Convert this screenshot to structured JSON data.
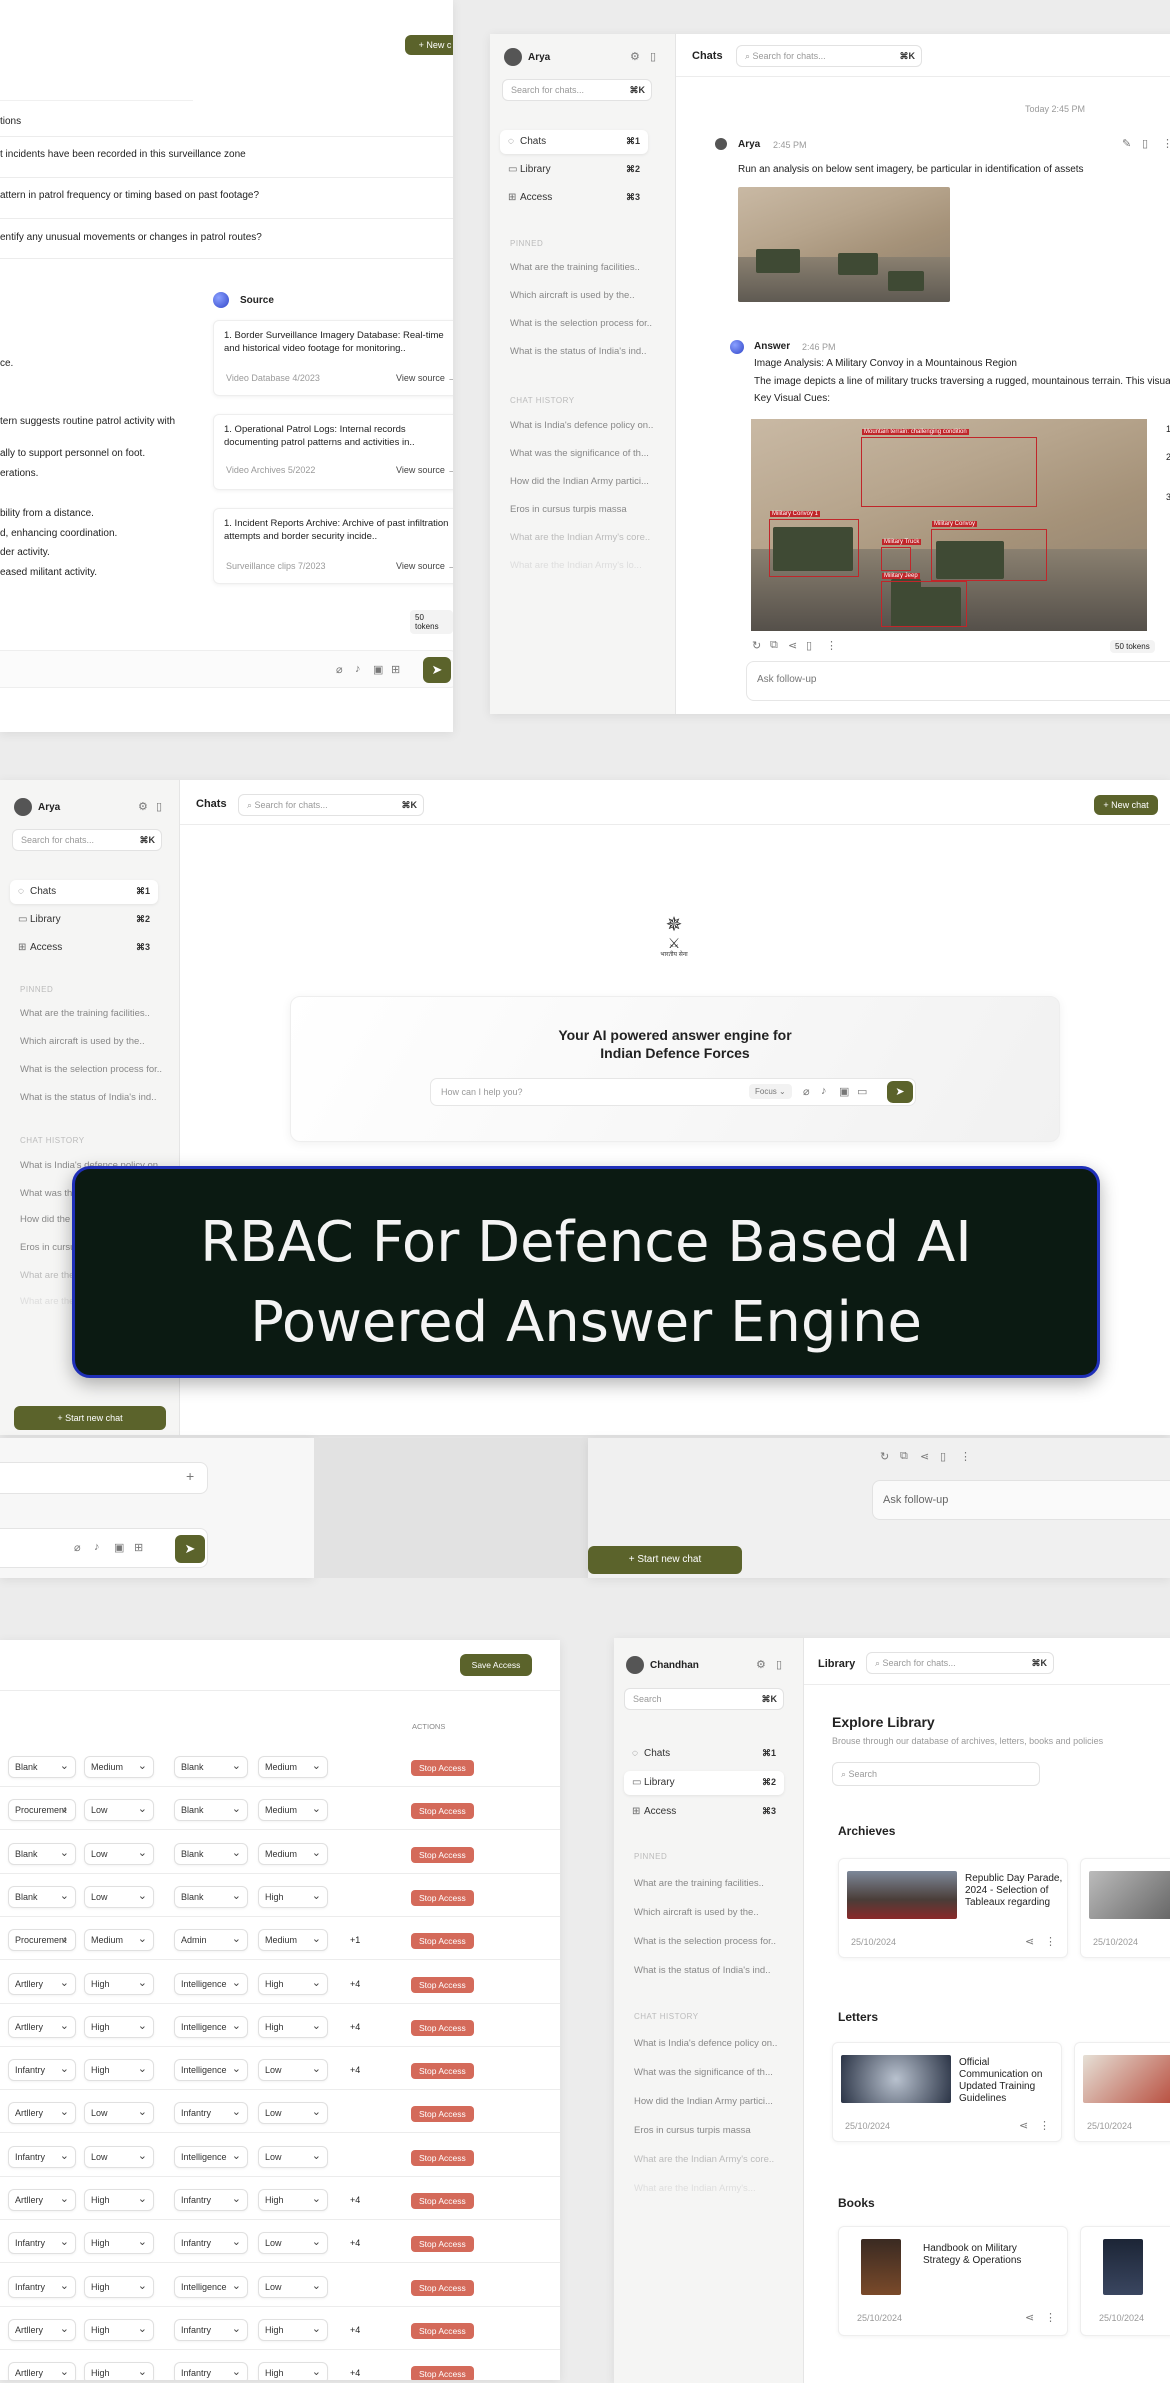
{
  "banner": {
    "line1": "RBAC For Defence Based AI",
    "line2": "Powered Answer Engine"
  },
  "panel1": {
    "new_chat": "+ New c",
    "related_header": "tions",
    "related": [
      "t incidents have been recorded in this surveillance zone",
      "attern in patrol frequency or timing based on past footage?",
      "entify any unusual movements or changes in patrol routes?"
    ],
    "answer_lines": [
      "ce.",
      "tern suggests routine patrol activity with",
      "ally to support personnel on foot.",
      "erations.",
      "bility from a distance.",
      "d, enhancing coordination.",
      "der activity.",
      "eased militant activity."
    ],
    "source_title": "Source",
    "sources": [
      {
        "text": "1. Border Surveillance Imagery Database: Real-time and historical video footage for monitoring..",
        "meta": "Video Database 4/2023",
        "link": "View source →"
      },
      {
        "text": "1. Operational Patrol Logs: Internal records documenting patrol patterns and activities in..",
        "meta": "Video Archives 5/2022",
        "link": "View source →"
      },
      {
        "text": "1. Incident Reports Archive: Archive of past infiltration attempts and border security incide..",
        "meta": "Surveillance clips 7/2023",
        "link": "View source →"
      }
    ],
    "tokens": "50 tokens"
  },
  "panel2": {
    "user": "Arya",
    "search": "Search for chats...",
    "search_key": "⌘K",
    "nav": [
      {
        "label": "Chats",
        "key": "⌘1"
      },
      {
        "label": "Library",
        "key": "⌘2"
      },
      {
        "label": "Access",
        "key": "⌘3"
      }
    ],
    "pinned_label": "PINNED",
    "pinned": [
      "What are the training facilities..",
      "Which aircraft is used by the..",
      "What is the selection process for..",
      "What is the status of India's ind.."
    ],
    "history_label": "CHAT HISTORY",
    "history": [
      "What is India's defence policy on..",
      "What was the significance of th...",
      "How did the Indian Army partici...",
      "Eros in cursus turpis massa",
      "What are the Indian Army's core..",
      "What are the Indian Army's lo..."
    ],
    "header_title": "Chats",
    "header_search": "Search for chats...",
    "header_key": "⌘K",
    "date": "Today 2:45 PM",
    "msg_user": "Arya",
    "msg_time": "2:45 PM",
    "msg_text": "Run an analysis on below sent imagery, be particular in identification of assets",
    "ans_label": "Answer",
    "ans_time": "2:46 PM",
    "ans_title": "Image Analysis: A Military Convoy in a Mountainous Region",
    "ans_desc": "The image depicts a line of military trucks traversing a rugged, mountainous terrain. This visual evi",
    "ans_cues": "Key Visual Cues:",
    "bbox_labels": [
      "Mountain terrain: challenging condition",
      "Military Convoy 1",
      "Military Truck",
      "Military Convoy",
      "Military Jeep"
    ],
    "side_nums": [
      "1",
      "2",
      "3"
    ],
    "tokens": "50 tokens",
    "followup": "Ask follow-up"
  },
  "panel3": {
    "user": "Arya",
    "search": "Search for chats...",
    "search_key": "⌘K",
    "nav": [
      {
        "label": "Chats",
        "key": "⌘1"
      },
      {
        "label": "Library",
        "key": "⌘2"
      },
      {
        "label": "Access",
        "key": "⌘3"
      }
    ],
    "pinned_label": "PINNED",
    "pinned": [
      "What are the training facilities..",
      "Which aircraft is used by the..",
      "What is the selection process for..",
      "What is the status of India's ind.."
    ],
    "history_label": "CHAT HISTORY",
    "history": [
      "What is India's defence policy on..",
      "What was the",
      "How did the",
      "Eros in cursus",
      "What are the",
      "What are the"
    ],
    "header_title": "Chats",
    "header_search": "Search for chats...",
    "header_key": "⌘K",
    "new_chat": "+ New chat",
    "emblem_text": "भारतीय सेना",
    "hero_title_1": "Your AI powered answer engine for",
    "hero_title_2": "Indian Defence Forces",
    "input_placeholder": "How can I help you?",
    "focus": "Focus",
    "start_new": "+ Start new chat"
  },
  "strip": {
    "followup": "Ask follow-up",
    "start_new": "+ Start new chat"
  },
  "panel5": {
    "save": "Save Access",
    "actions_label": "ACTIONS",
    "stop": "Stop Access",
    "rows": [
      [
        "Blank",
        "Medium",
        "Blank",
        "Medium",
        ""
      ],
      [
        "Procurement",
        "Low",
        "Blank",
        "Medium",
        ""
      ],
      [
        "Blank",
        "Low",
        "Blank",
        "Medium",
        ""
      ],
      [
        "Blank",
        "Low",
        "Blank",
        "High",
        ""
      ],
      [
        "Procurement",
        "Medium",
        "Admin",
        "Medium",
        "+1"
      ],
      [
        "Artllery",
        "High",
        "Intelligence",
        "High",
        "+4"
      ],
      [
        "Artllery",
        "High",
        "Intelligence",
        "High",
        "+4"
      ],
      [
        "Infantry",
        "High",
        "Intelligence",
        "Low",
        "+4"
      ],
      [
        "Artllery",
        "Low",
        "Infantry",
        "Low",
        ""
      ],
      [
        "Infantry",
        "Low",
        "Intelligence",
        "Low",
        ""
      ],
      [
        "Artllery",
        "High",
        "Infantry",
        "High",
        "+4"
      ],
      [
        "Infantry",
        "High",
        "Infantry",
        "Low",
        "+4"
      ],
      [
        "Infantry",
        "High",
        "Intelligence",
        "Low",
        ""
      ],
      [
        "Artllery",
        "High",
        "Infantry",
        "High",
        "+4"
      ],
      [
        "Artllery",
        "High",
        "Infantry",
        "High",
        "+4"
      ]
    ]
  },
  "panel6": {
    "user": "Chandhan",
    "search": "Search",
    "search_key": "⌘K",
    "nav": [
      {
        "label": "Chats",
        "key": "⌘1"
      },
      {
        "label": "Library",
        "key": "⌘2"
      },
      {
        "label": "Access",
        "key": "⌘3"
      }
    ],
    "pinned_label": "PINNED",
    "pinned": [
      "What are the training facilities..",
      "Which aircraft is used by the..",
      "What is the selection process for..",
      "What is the status of India's ind.."
    ],
    "history_label": "CHAT HISTORY",
    "history": [
      "What is India's defence policy on..",
      "What was the significance of th...",
      "How did the Indian Army partici...",
      "Eros in cursus turpis massa",
      "What are the Indian Army's core..",
      "What are the Indian Army's..."
    ],
    "header_title": "Library",
    "header_search": "Search for chats...",
    "header_key": "⌘K",
    "title": "Explore Library",
    "subtitle": "Brouse through our database of archives, letters, books and policies",
    "archives": "Archieves",
    "archive_card": "Republic Day Parade, 2024 - Selection of Tableaux regarding",
    "archive_date": "25/10/2024",
    "letters": "Letters",
    "letter_card": "Official Communication on Updated Training Guidelines",
    "letter_date": "25/10/2024",
    "books": "Books",
    "book_card": "Handbook on Military Strategy & Operations",
    "book_date": "25/10/2024"
  }
}
